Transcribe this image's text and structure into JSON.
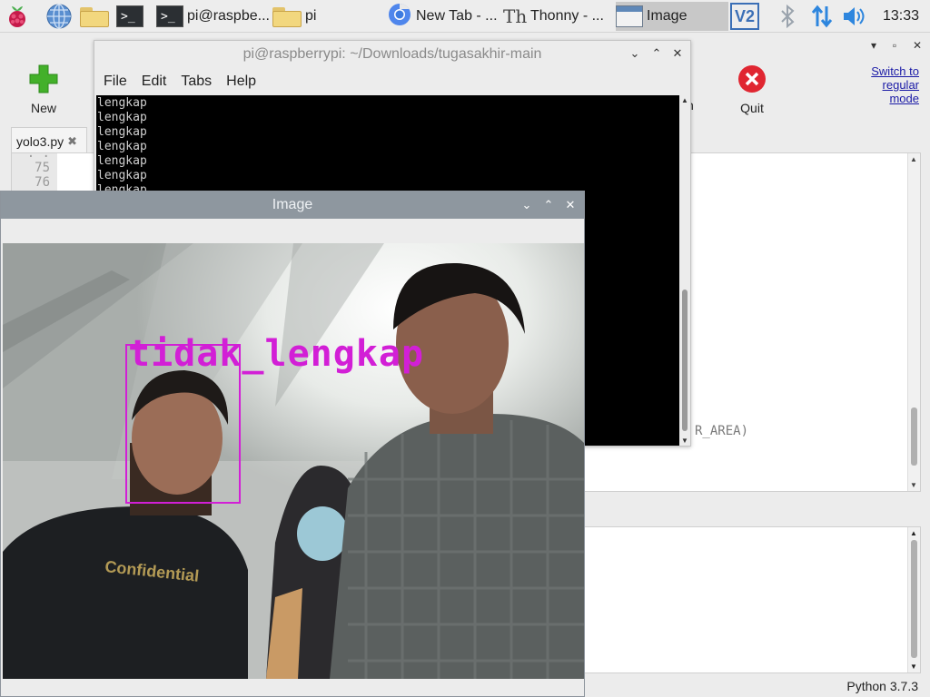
{
  "panel": {
    "tasks": [
      {
        "label": "pi@raspbe..."
      },
      {
        "label": "pi"
      },
      {
        "label": "New Tab - ..."
      },
      {
        "label": "Thonny  -  ..."
      },
      {
        "label": "Image"
      }
    ],
    "clock": "13:33"
  },
  "thonny": {
    "toolbar": {
      "new_label": "New",
      "quit_label": "Quit",
      "partial_label": "n"
    },
    "switch_mode": "Switch to regular mode",
    "tab_file": "yolo3.py",
    "gutter_lines": [
      "75",
      "76"
    ],
    "editor_code_fragment": "R_AREA)",
    "status": "Python 3.7.3"
  },
  "terminal": {
    "title": "pi@raspberrypi: ~/Downloads/tugasakhir-main",
    "menu": [
      "File",
      "Edit",
      "Tabs",
      "Help"
    ],
    "lines": [
      "lengkap",
      "lengkap",
      "lengkap",
      "lengkap",
      "lengkap",
      "lengkap",
      "lengkap"
    ]
  },
  "image_window": {
    "title": "Image",
    "detection_label": "tidak_lengkap",
    "box_color": "#d21fd6"
  },
  "colors": {
    "panel_bg": "#ededed",
    "active_task": "#c8c8c8",
    "image_titlebar": "#8e979f",
    "link": "#1a1aa6",
    "quit_red": "#e02631",
    "new_green": "#43b02a"
  },
  "icons": [
    "raspberry-menu-icon",
    "web-browser-icon",
    "file-manager-icon",
    "terminal-icon",
    "folder-icon",
    "chromium-icon",
    "thonny-icon",
    "image-window-icon",
    "vnc-icon",
    "bluetooth-icon",
    "network-icon",
    "volume-icon"
  ]
}
